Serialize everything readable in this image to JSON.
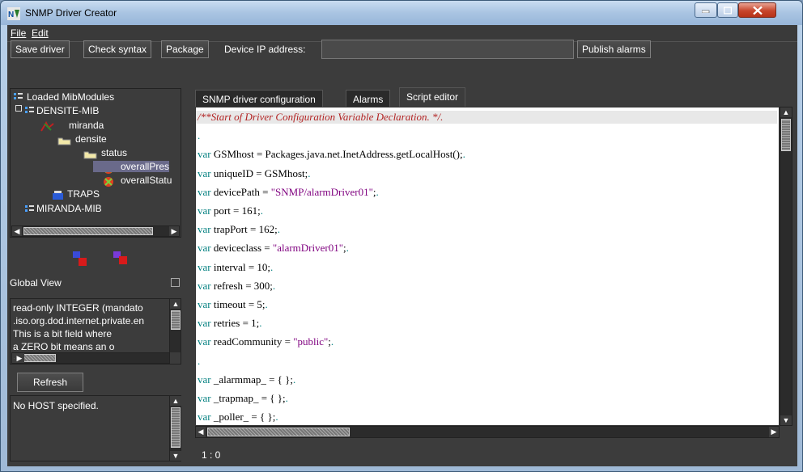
{
  "window": {
    "title": "SNMP Driver Creator"
  },
  "menu": {
    "file": "File",
    "edit": "Edit"
  },
  "toolbar": {
    "save_driver": "Save driver",
    "check_syntax": "Check syntax",
    "package": "Package",
    "ip_label": "Device IP address:",
    "ip_value": "",
    "publish_alarms": "Publish alarms"
  },
  "tree": {
    "items": [
      {
        "label": "Loaded MibModules"
      },
      {
        "label": "DENSITE-MIB"
      },
      {
        "label": "miranda"
      },
      {
        "label": "densite"
      },
      {
        "label": "status"
      },
      {
        "label": "overallPres"
      },
      {
        "label": "overallStatu"
      },
      {
        "label": "TRAPS"
      },
      {
        "label": "MIRANDA-MIB"
      }
    ]
  },
  "global_view": {
    "label": "Global View"
  },
  "description": {
    "lines": [
      "read-only INTEGER  (mandato",
      ".iso.org.dod.internet.private.en",
      "This is a bit field where",
      "    a ZERO bit means an o"
    ]
  },
  "refresh_label": "Refresh",
  "host_status": "No HOST specified.",
  "tabs": [
    {
      "label": "SNMP driver configuration",
      "active": false
    },
    {
      "label": "Alarms",
      "active": false
    },
    {
      "label": "Script editor",
      "active": true
    }
  ],
  "editor": {
    "lines": [
      {
        "type": "comment",
        "text": "/**Start of Driver Configuration Variable Declaration. */."
      },
      {
        "type": "blank",
        "text": "."
      },
      {
        "type": "var",
        "name": "GSMhost",
        "value": "Packages.java.net.InetAddress.getLocalHost()",
        "is_string": false
      },
      {
        "type": "var",
        "name": "uniqueID",
        "value": "GSMhost",
        "is_string": false
      },
      {
        "type": "var",
        "name": "devicePath",
        "value": "\"SNMP/alarmDriver01\"",
        "is_string": true
      },
      {
        "type": "var",
        "name": "port",
        "value": "161",
        "is_string": false
      },
      {
        "type": "var",
        "name": "trapPort",
        "value": "162",
        "is_string": false
      },
      {
        "type": "var",
        "name": "deviceclass",
        "value": "\"alarmDriver01\"",
        "is_string": true
      },
      {
        "type": "var",
        "name": "interval",
        "value": "10",
        "is_string": false
      },
      {
        "type": "var",
        "name": "refresh",
        "value": "300",
        "is_string": false
      },
      {
        "type": "var",
        "name": "timeout",
        "value": "5",
        "is_string": false
      },
      {
        "type": "var",
        "name": "retries",
        "value": "1",
        "is_string": false
      },
      {
        "type": "var",
        "name": "readCommunity",
        "value": "\"public\"",
        "is_string": true
      },
      {
        "type": "blank",
        "text": "."
      },
      {
        "type": "var",
        "name": "_alarmmap_",
        "value": "{ }",
        "is_string": false
      },
      {
        "type": "var",
        "name": "_trapmap_",
        "value": "{ }",
        "is_string": false
      },
      {
        "type": "var",
        "name": "_poller_",
        "value": "{ }",
        "is_string": false
      }
    ],
    "cursor_position": "1 : 0"
  }
}
